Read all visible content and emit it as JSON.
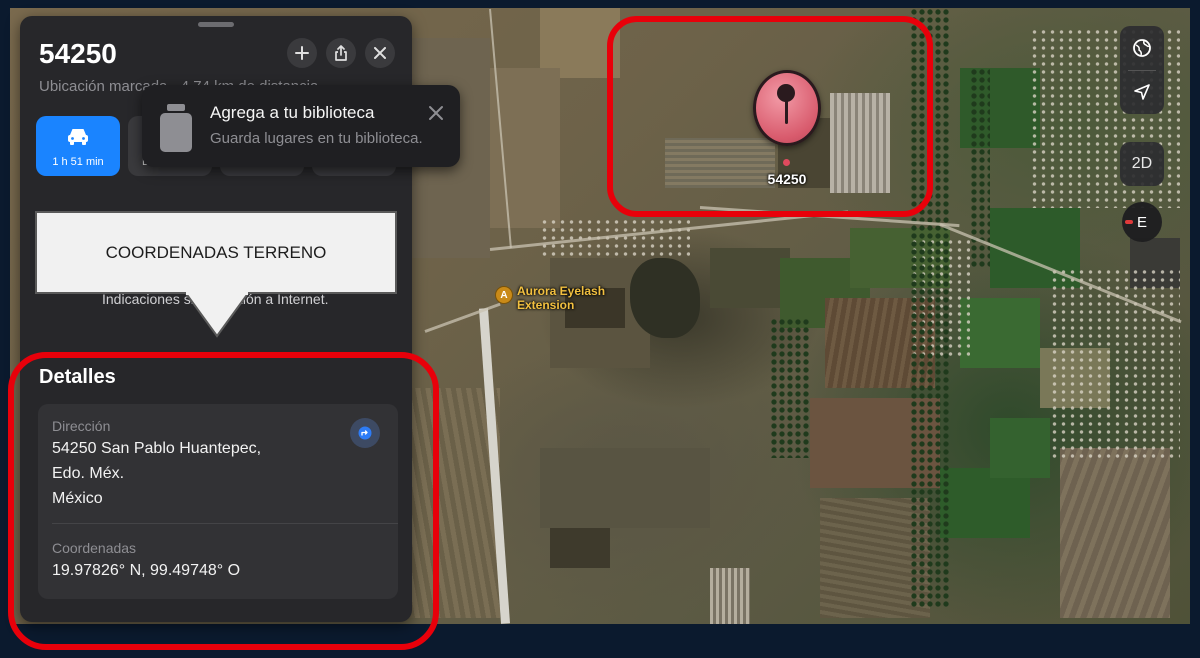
{
  "panel": {
    "title": "54250",
    "subtitle": "Ubicación marcada · 4,74 km de distancia",
    "route_time": "1 h 51 min",
    "route_partials": [
      "D",
      "",
      ""
    ],
    "offline_text": "Indicaciones sin conexión a Internet.",
    "details_heading": "Detalles",
    "address_label": "Dirección",
    "address_lines": [
      "54250 San Pablo Huantepec,",
      "Edo. Méx.",
      "México"
    ],
    "coords_label": "Coordenadas",
    "coords_value": "19.97826° N, 99.49748° O"
  },
  "toast": {
    "title": "Agrega a tu biblioteca",
    "subtitle": "Guarda lugares en tu biblioteca."
  },
  "callout": {
    "text": "COORDENADAS TERRENO"
  },
  "map": {
    "pin_label": "54250",
    "poi_name_line1": "Aurora Eyelash",
    "poi_name_line2": "Extension",
    "mode_button": "2D",
    "compass_letter": "E"
  },
  "icons": {
    "add": "plus-icon",
    "share": "share-icon",
    "close": "close-icon",
    "car": "car-icon",
    "globe": "globe-icon",
    "location": "location-arrow-icon",
    "library": "library-icon",
    "directions": "directions-icon"
  },
  "colors": {
    "accent": "#1a84ff",
    "pin": "#d85a6c",
    "annotation_ring": "#e8000a",
    "panel_bg": "#27272a"
  }
}
